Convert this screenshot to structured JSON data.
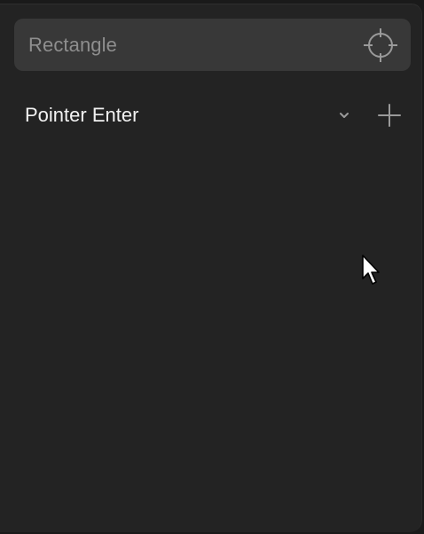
{
  "target": {
    "placeholder": "Rectangle",
    "pick_icon": "crosshair-icon"
  },
  "event": {
    "label": "Pointer Enter",
    "dropdown_icon": "chevron-down-icon",
    "add_icon": "plus-icon"
  },
  "colors": {
    "background": "#1a1a1a",
    "panel": "#232323",
    "field": "#383838",
    "placeholder_text": "#8e8e8e",
    "label_text": "#f2f2f2",
    "icon": "#9a9a9a"
  }
}
